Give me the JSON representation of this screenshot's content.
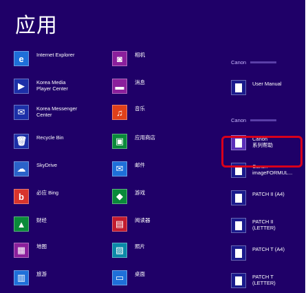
{
  "title": "应用",
  "columns": [
    {
      "items": [
        {
          "label": "Internet Explorer",
          "icon": "internet-explorer-icon",
          "color": "#1e6fd9",
          "glyph": "e"
        },
        {
          "label": "Korea Media\nPlayer Center",
          "icon": "media-player-icon",
          "color": "#1c2fa8",
          "glyph": "▶"
        },
        {
          "label": "Korea Messenger\nCenter",
          "icon": "messenger-icon",
          "color": "#1c2fa8",
          "glyph": "✉"
        },
        {
          "label": "Recycle Bin",
          "icon": "recycle-bin-icon",
          "color": "#1c2fa8",
          "glyph": "🗑"
        },
        {
          "label": "SkyDrive",
          "icon": "skydrive-icon",
          "color": "#2a62c9",
          "glyph": "☁"
        },
        {
          "label": "必应 Bing",
          "icon": "bing-icon",
          "color": "#d8342c",
          "glyph": "b"
        },
        {
          "label": "财经",
          "icon": "finance-icon",
          "color": "#0a8a3a",
          "glyph": "▲"
        },
        {
          "label": "地图",
          "icon": "maps-icon",
          "color": "#8b1f9c",
          "glyph": "▦"
        },
        {
          "label": "旅游",
          "icon": "travel-icon",
          "color": "#1e6fd9",
          "glyph": "▥"
        }
      ]
    },
    {
      "items": [
        {
          "label": "相机",
          "icon": "camera-icon",
          "color": "#8b1f9c",
          "glyph": "◙"
        },
        {
          "label": "消息",
          "icon": "messaging-icon",
          "color": "#8b1f9c",
          "glyph": "▬"
        },
        {
          "label": "音乐",
          "icon": "music-icon",
          "color": "#e0401a",
          "glyph": "♫"
        },
        {
          "label": "应用商店",
          "icon": "store-icon",
          "color": "#0a8a3a",
          "glyph": "▣"
        },
        {
          "label": "邮件",
          "icon": "mail-icon",
          "color": "#1e6fd9",
          "glyph": "✉"
        },
        {
          "label": "游戏",
          "icon": "games-icon",
          "color": "#0a8a3a",
          "glyph": "◆"
        },
        {
          "label": "阅读器",
          "icon": "reader-icon",
          "color": "#c21b2e",
          "glyph": "▤"
        },
        {
          "label": "照片",
          "icon": "photos-icon",
          "color": "#0b8aa8",
          "glyph": "▨"
        },
        {
          "label": "桌面",
          "icon": "desktop-icon",
          "color": "#1e6fd9",
          "glyph": "▭"
        }
      ]
    },
    {
      "groups": [
        {
          "name": "Canon"
        },
        {
          "name": "Canon"
        }
      ],
      "items": [
        {
          "label": "User Manual",
          "icon": "user-manual-icon",
          "color": "#1a1a8c"
        },
        {
          "label": "Canon\n系列帮助",
          "icon": "canon-help-icon",
          "color": "#5a2fb8"
        },
        {
          "label": "Canon\nimageFORMUL...",
          "icon": "canon-imageformula-icon",
          "color": "#1a1a8c"
        },
        {
          "label": "PATCH II (A4)",
          "icon": "patch-ii-a4-icon",
          "color": "#1a1a8c"
        },
        {
          "label": "PATCH II\n(LETTER)",
          "icon": "patch-ii-letter-icon",
          "color": "#1a1a8c"
        },
        {
          "label": "PATCH T (A4)",
          "icon": "patch-t-a4-icon",
          "color": "#1a1a8c"
        },
        {
          "label": "PATCH T\n(LETTER)",
          "icon": "patch-t-letter-icon",
          "color": "#1a1a8c"
        }
      ]
    }
  ],
  "highlight_color": "#d9001b",
  "background": "#1f0068"
}
